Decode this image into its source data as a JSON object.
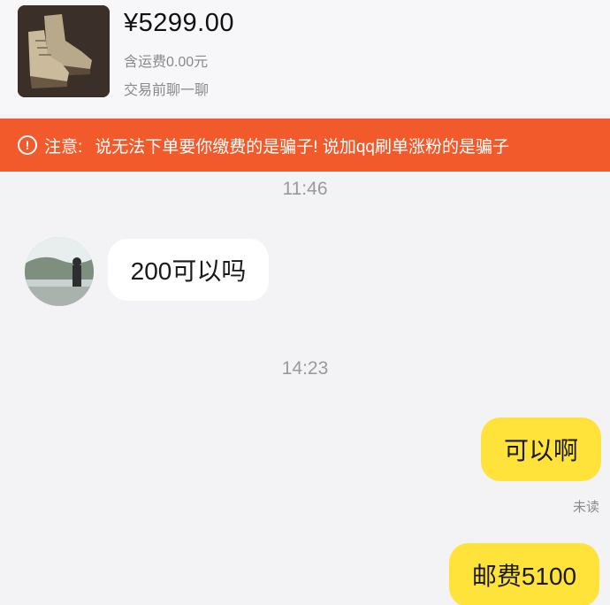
{
  "product": {
    "price": "¥5299.00",
    "shipping": "含运费0.00元",
    "chat_hint": "交易前聊一聊",
    "thumbnail_icon": "boots-image"
  },
  "warning": {
    "icon": "exclamation-circle-icon",
    "label": "注意:",
    "text": "说无法下单要你缴费的是骗子! 说加qq刷单涨粉的是骗子"
  },
  "messages": [
    {
      "time": "11:46"
    },
    {
      "from": "other",
      "text": "200可以吗"
    },
    {
      "time": "14:23"
    },
    {
      "from": "me",
      "text": "可以啊",
      "status": "未读"
    },
    {
      "from": "me",
      "text": "邮费5100"
    }
  ],
  "colors": {
    "warning_bg": "#f25a2b",
    "outgoing_bubble": "#ffe23a",
    "incoming_bubble": "#ffffff"
  }
}
